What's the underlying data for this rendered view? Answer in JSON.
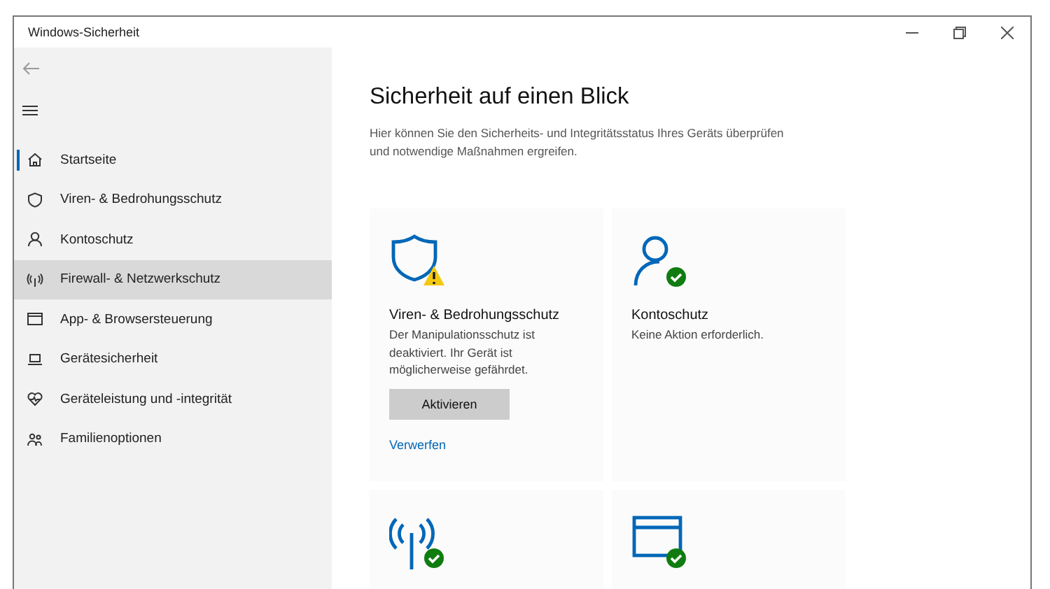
{
  "window": {
    "title": "Windows-Sicherheit"
  },
  "sidebar": {
    "items": [
      {
        "label": "Startseite",
        "kind": "home",
        "selected": true,
        "hovered": false
      },
      {
        "label": "Viren- & Bedrohungsschutz",
        "kind": "shield",
        "selected": false,
        "hovered": false
      },
      {
        "label": "Kontoschutz",
        "kind": "person",
        "selected": false,
        "hovered": false
      },
      {
        "label": "Firewall- & Netzwerkschutz",
        "kind": "antenna",
        "selected": false,
        "hovered": true
      },
      {
        "label": "App- & Browsersteuerung",
        "kind": "browser",
        "selected": false,
        "hovered": false
      },
      {
        "label": "Gerätesicherheit",
        "kind": "laptop",
        "selected": false,
        "hovered": false
      },
      {
        "label": "Geräteleistung und -integrität",
        "kind": "heart",
        "selected": false,
        "hovered": false
      },
      {
        "label": "Familienoptionen",
        "kind": "family",
        "selected": false,
        "hovered": false
      }
    ]
  },
  "main": {
    "title": "Sicherheit auf einen Blick",
    "description": "Hier können Sie den Sicherheits- und Integritätsstatus Ihres Geräts überprüfen und notwendige Maßnahmen ergreifen.",
    "cards": [
      {
        "kind": "shield",
        "warning": true,
        "title": "Viren- & Bedrohungsschutz",
        "text": "Der Manipulationsschutz ist deaktiviert. Ihr Gerät ist möglicherweise gefährdet.",
        "button": "Aktivieren",
        "link": "Verwerfen"
      },
      {
        "kind": "person",
        "warning": false,
        "title": "Kontoschutz",
        "text": "Keine Aktion erforderlich."
      },
      {
        "kind": "antenna",
        "warning": false
      },
      {
        "kind": "browser",
        "warning": false
      }
    ]
  }
}
